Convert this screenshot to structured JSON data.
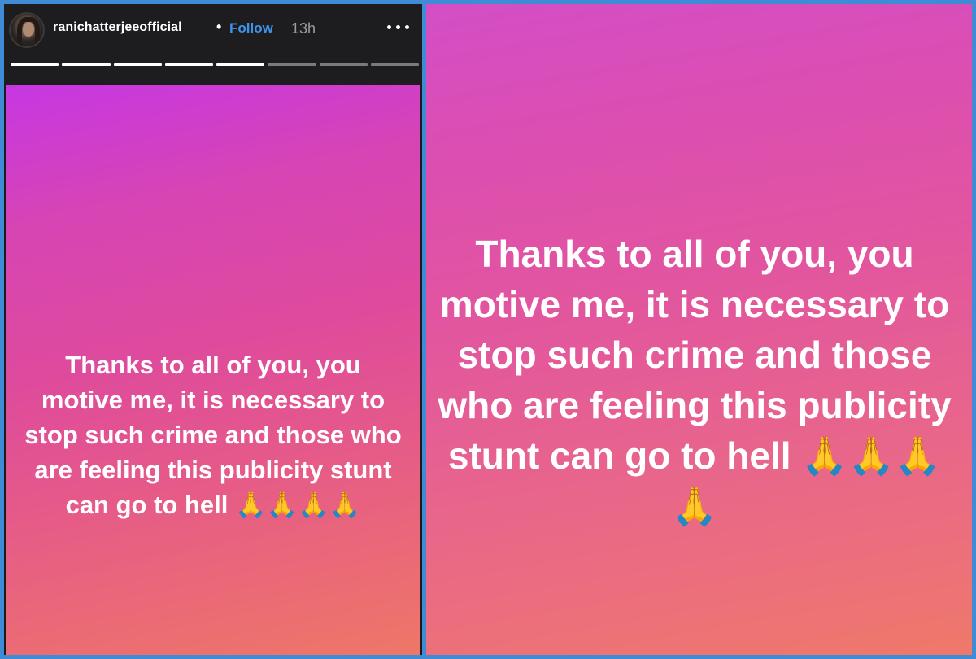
{
  "left_panel": {
    "header": {
      "username": "ranichatterjeeofficial",
      "separator": "•",
      "follow_label": "Follow",
      "time": "13h",
      "more_label": "•••"
    },
    "progress": {
      "total_segments": 8,
      "completed_segments": 5,
      "active_color": "#ffffff",
      "inactive_color": "#7a7a7a"
    },
    "story_text": "Thanks to all of you, you motive me, it is necessary to stop such crime and those who are feeling this publicity stunt can go to hell",
    "story_emoji": "🙏🙏🙏🙏"
  },
  "right_panel": {
    "story_text": "Thanks to all of you, you motive me, it is necessary to stop such crime and those who are feeling this publicity stunt can go to hell",
    "story_emoji": "🙏🙏🙏🙏"
  },
  "colors": {
    "frame_border": "#3f8bd6",
    "follow": "#3e93e8",
    "gradient_top": "#c637e3",
    "gradient_bottom": "#ee7767"
  }
}
